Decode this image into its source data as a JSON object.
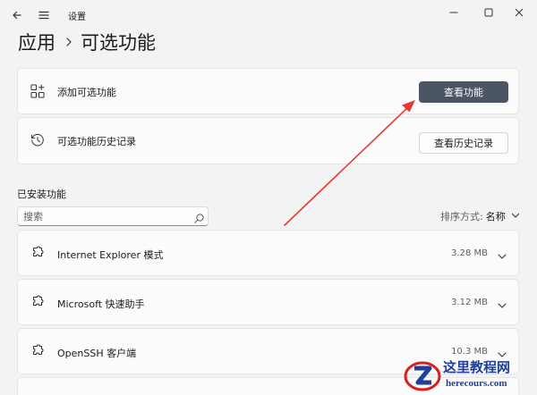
{
  "window": {
    "title": "设置",
    "controls": {
      "minimize_icon": "minimize-icon",
      "maximize_icon": "maximize-icon",
      "close_icon": "close-icon"
    }
  },
  "header": {
    "breadcrumb_parent": "应用",
    "breadcrumb_current": "可选功能"
  },
  "cards": {
    "add": {
      "label": "添加可选功能",
      "button": "查看功能",
      "icon": "add-feature-icon"
    },
    "history": {
      "label": "可选功能历史记录",
      "button": "查看历史记录",
      "icon": "history-icon"
    }
  },
  "installed": {
    "section_title": "已安装功能",
    "search_placeholder": "搜索",
    "sort_label": "排序方式:",
    "sort_value": "名称",
    "items": [
      {
        "name": "Internet Explorer 模式",
        "size": "3.28 MB",
        "icon": "puzzle-icon"
      },
      {
        "name": "Microsoft 快速助手",
        "size": "3.12 MB",
        "icon": "puzzle-icon"
      },
      {
        "name": "OpenSSH 客户端",
        "size": "10.3 MB",
        "icon": "puzzle-icon"
      }
    ]
  },
  "watermark": {
    "title": "这里教程网",
    "url": "herecours.com"
  },
  "colors": {
    "accent_button": "#4b5563",
    "annotation_arrow": "#e53935",
    "watermark_blue": "#1f3f9a",
    "watermark_red": "#d81e1e"
  }
}
